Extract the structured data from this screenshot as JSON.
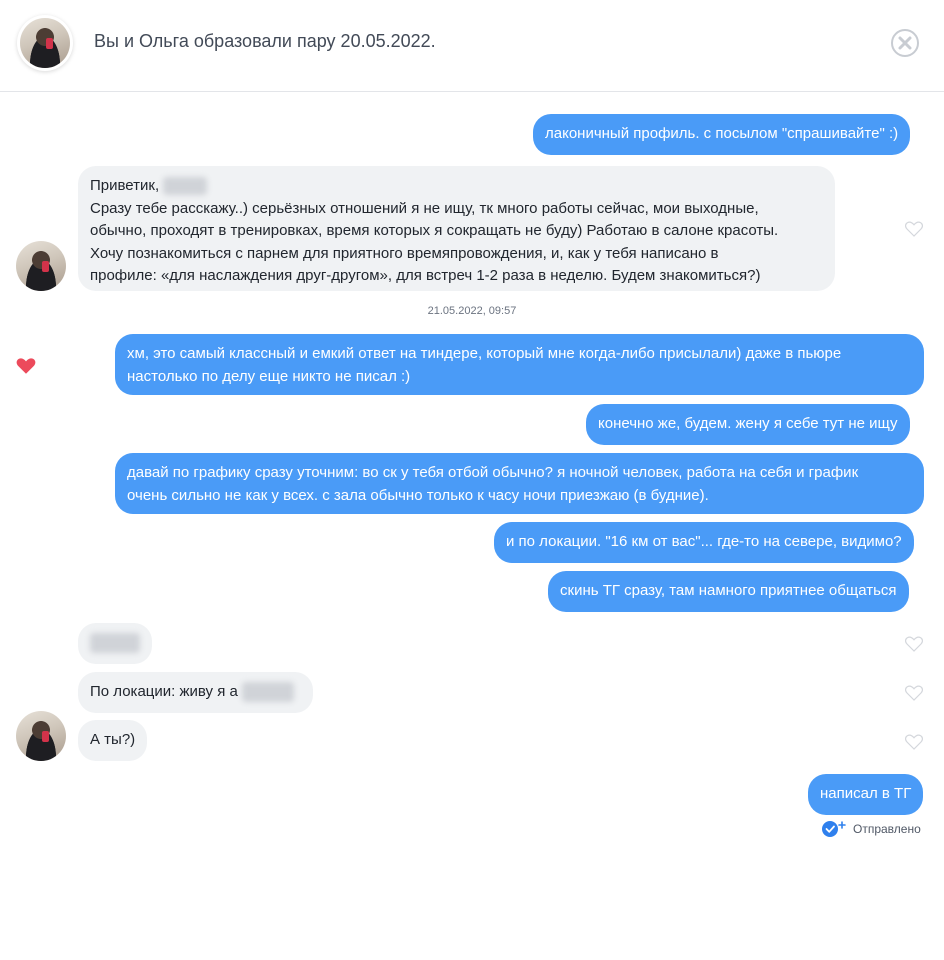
{
  "header": {
    "title": "Вы и Ольга образовали пару 20.05.2022."
  },
  "messages": {
    "m1": "лаконичный профиль. с посылом \"спрашивайте\" :)",
    "m2": {
      "line1": "Приветик,",
      "line2": "Сразу тебе расскажу..) серьёзных отношений я не ищу, тк много работы сейчас, мои выходные,",
      "line3": "обычно, проходят в тренировках, время которых я сокращать не буду) Работаю в салоне красоты.",
      "line4": "Хочу познакомиться с парнем для приятного времяпровождения, и, как у тебя написано в",
      "line5": "профиле: «для наслаждения друг-другом»,  для встреч 1-2 раза в неделю. Будем знакомиться?)"
    },
    "timestamp": "21.05.2022, 09:57",
    "m3": {
      "line1": "хм, это самый классный и емкий ответ на тиндере, который мне когда-либо присылали) даже в пьюре",
      "line2": "настолько по делу еще никто не писал :)"
    },
    "m4": "конечно же, будем. жену я себе тут не ищу",
    "m5": {
      "line1": "давай по графику сразу уточним: во ск у тебя отбой обычно? я ночной человек, работа на себя и график",
      "line2": "очень сильно не как у всех. с зала обычно только к часу ночи приезжаю (в будние)."
    },
    "m6": "и по локации. \"16 км от вас\"... где-то на севере, видимо?",
    "m7": "скинь ТГ сразу, там намного приятнее общаться",
    "m9": "По локации: живу я а",
    "m10": "А ты?)",
    "m11": "написал в ТГ",
    "sent_label": "Отправлено"
  },
  "icons": {
    "close": "close-circle-icon",
    "heart_liked": "heart-filled-icon",
    "heart_unliked": "heart-outline-icon",
    "delivered": "double-check-icon"
  },
  "colors": {
    "outgoing_bubble": "#4a9bf7",
    "incoming_bubble": "#f0f2f4",
    "liked_heart": "#ec4a5b"
  }
}
